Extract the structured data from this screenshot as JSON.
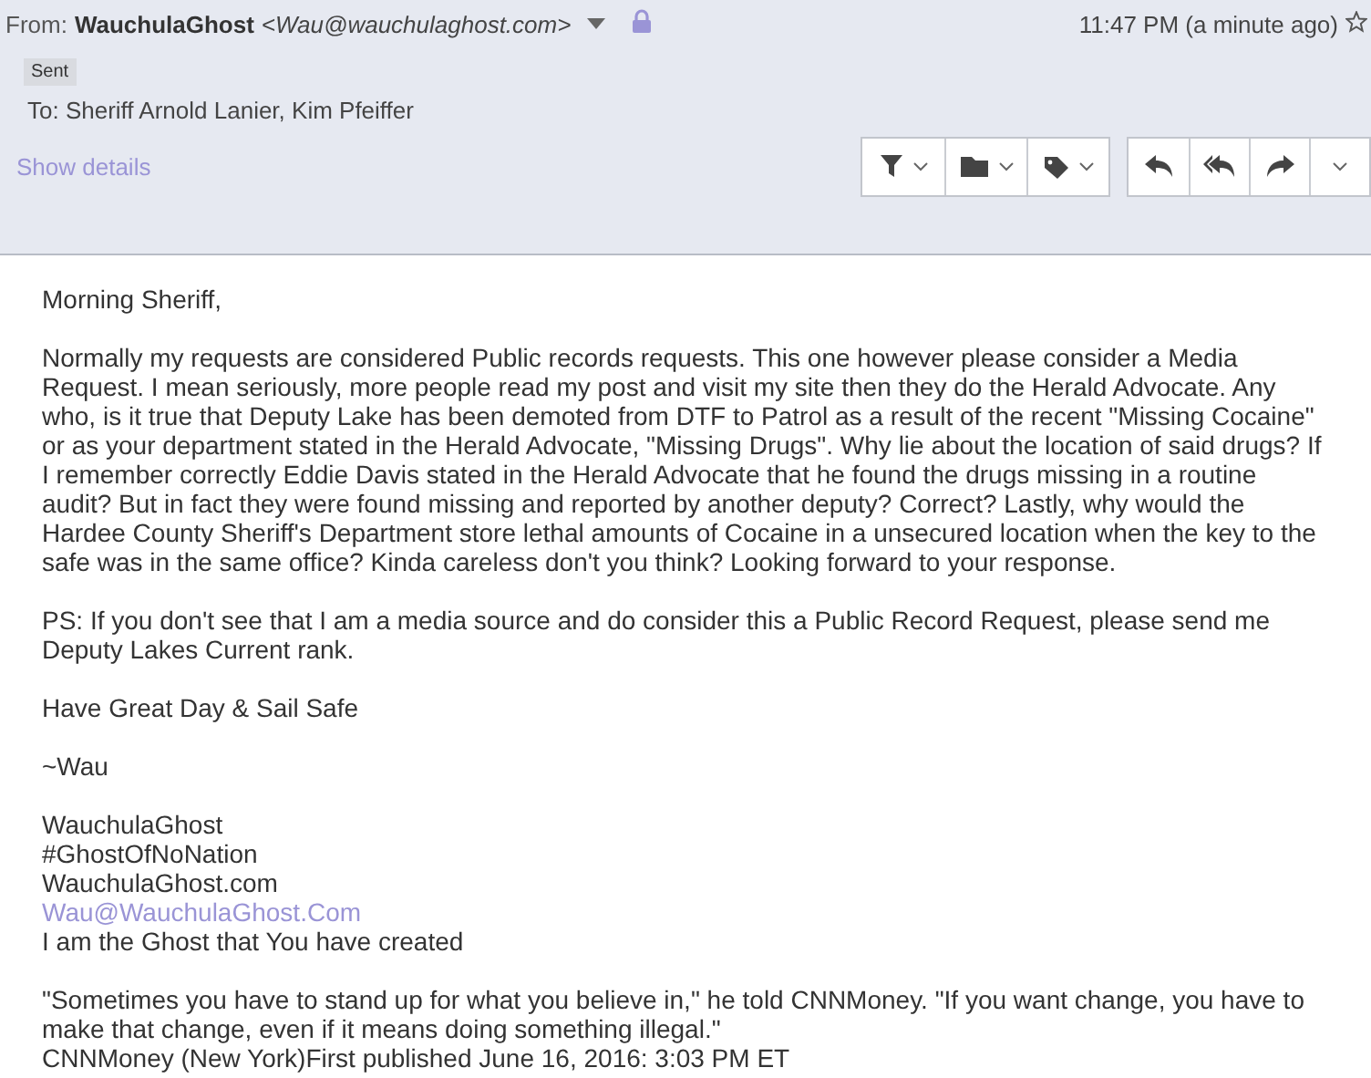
{
  "header": {
    "from_label": "From:",
    "sender_name": "WauchulaGhost",
    "sender_email": "<Wau@wauchulaghost.com>",
    "time": "11:47 PM (a minute ago)",
    "starred": false,
    "tag": "Sent",
    "to_label": "To:",
    "recipients": "Sheriff Arnold Lanier, Kim Pfeiffer",
    "show_details": "Show details"
  },
  "body": [
    {
      "lines": [
        {
          "kind": "text",
          "text": "Morning Sheriff,"
        }
      ]
    },
    {
      "lines": [
        {
          "kind": "text",
          "text": "Normally my requests are considered Public records requests. This one however please consider a Media Request. I mean seriously, more people read my post and visit my site then they do the Herald Advocate. Any who, is it true that Deputy Lake has been demoted from DTF to Patrol as a result of the recent \"Missing Cocaine\" or as your department stated in the Herald Advocate, \"Missing Drugs\". Why lie about the location of said drugs? If I remember correctly Eddie Davis stated in the Herald Advocate that he found the drugs missing in a routine audit? But in fact they were found missing and reported by another deputy? Correct? Lastly, why would the Hardee County Sheriff's Department store lethal amounts of Cocaine in a unsecured location when the key to the safe was in the same office? Kinda careless don't you think? Looking forward to your response."
        }
      ]
    },
    {
      "lines": [
        {
          "kind": "text",
          "text": "PS: If you don't see that I am a media source and do consider this a Public Record Request, please send me Deputy Lakes Current rank."
        }
      ]
    },
    {
      "lines": [
        {
          "kind": "text",
          "text": "Have Great Day & Sail Safe"
        }
      ]
    },
    {
      "lines": [
        {
          "kind": "text",
          "text": "~Wau"
        }
      ]
    },
    {
      "lines": [
        {
          "kind": "text",
          "text": "WauchulaGhost"
        },
        {
          "kind": "text",
          "text": "#GhostOfNoNation"
        },
        {
          "kind": "text",
          "text": "WauchulaGhost.com"
        },
        {
          "kind": "link",
          "text": "Wau@WauchulaGhost.Com"
        },
        {
          "kind": "text",
          "text": "I am the Ghost that You have created"
        }
      ]
    },
    {
      "lines": [
        {
          "kind": "text",
          "text": "\"Sometimes you have to stand up for what you believe in,\" he told CNNMoney. \"If you want change, you have to make that change, even if it means doing something illegal.\""
        },
        {
          "kind": "text",
          "text": "CNNMoney (New York)First published June 16, 2016: 3:03 PM ET"
        }
      ]
    }
  ]
}
